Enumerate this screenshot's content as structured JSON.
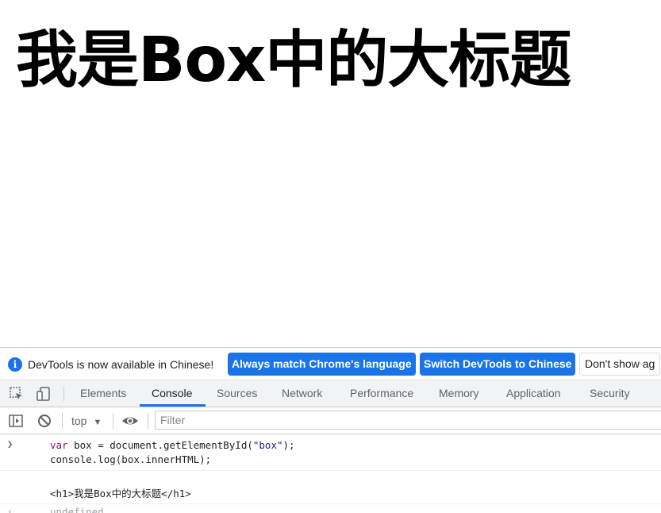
{
  "page": {
    "heading": "我是Box中的大标题"
  },
  "devtools": {
    "infobar": {
      "message": "DevTools is now available in Chinese!",
      "match_language_label": "Always match Chrome's language",
      "switch_label": "Switch DevTools to Chinese",
      "dont_show_label": "Don't show ag"
    },
    "tabs": [
      {
        "label": "Elements"
      },
      {
        "label": "Console"
      },
      {
        "label": "Sources"
      },
      {
        "label": "Network"
      },
      {
        "label": "Performance"
      },
      {
        "label": "Memory"
      },
      {
        "label": "Application"
      },
      {
        "label": "Security"
      }
    ],
    "active_tab": "Console",
    "toolbar": {
      "context": "top",
      "filter_placeholder": "Filter"
    },
    "console": {
      "input_lines": {
        "line1_kw": "var",
        "line1_a": " box = document.getElementById(",
        "line1_str": "\"box\"",
        "line1_b": ");",
        "line2": "console.log(box.innerHTML);"
      },
      "output": "<h1>我是Box中的大标题</h1>",
      "partial": "undefined"
    },
    "colors": {
      "accent": "#1a73e8",
      "keyword": "#881280",
      "string": "#1a1aa6"
    },
    "icons": [
      "info-icon",
      "inspect-element-icon",
      "device-toolbar-icon",
      "sidebar-toggle-icon",
      "clear-console-icon",
      "eye-icon"
    ]
  }
}
